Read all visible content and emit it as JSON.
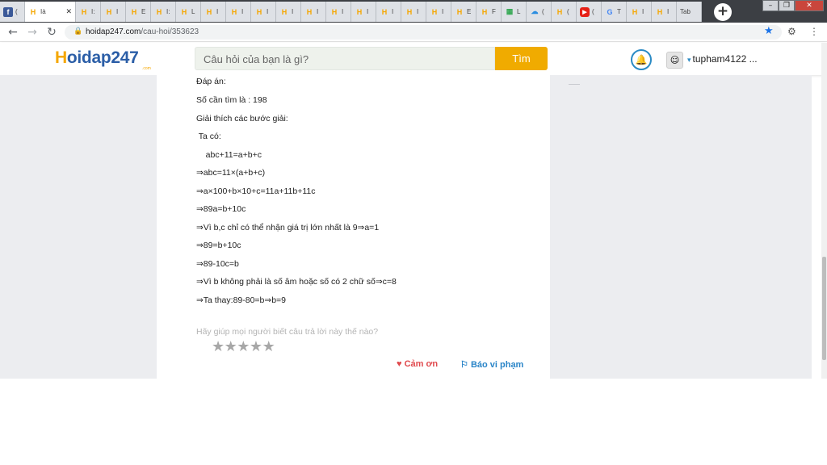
{
  "browser": {
    "tabs": [
      {
        "icon": "facebook-icon",
        "label": "("
      },
      {
        "icon": "hoidap-icon",
        "label": "Ià",
        "active": true
      },
      {
        "icon": "hoidap-icon",
        "label": "I:"
      },
      {
        "icon": "hoidap-icon",
        "label": "I"
      },
      {
        "icon": "hoidap-icon",
        "label": "E"
      },
      {
        "icon": "hoidap-icon",
        "label": "I:"
      },
      {
        "icon": "hoidap-icon",
        "label": "L"
      },
      {
        "icon": "hoidap-icon",
        "label": "I"
      },
      {
        "icon": "hoidap-icon",
        "label": "I"
      },
      {
        "icon": "hoidap-icon",
        "label": "I"
      },
      {
        "icon": "hoidap-icon",
        "label": "I"
      },
      {
        "icon": "hoidap-icon",
        "label": "I"
      },
      {
        "icon": "hoidap-icon",
        "label": "I"
      },
      {
        "icon": "hoidap-icon",
        "label": "I"
      },
      {
        "icon": "hoidap-icon",
        "label": "I"
      },
      {
        "icon": "hoidap-icon",
        "label": "I"
      },
      {
        "icon": "hoidap-icon",
        "label": "I"
      },
      {
        "icon": "hoidap-icon",
        "label": "E"
      },
      {
        "icon": "hoidap-icon",
        "label": "F"
      },
      {
        "icon": "sheets-icon",
        "label": "L"
      },
      {
        "icon": "cloud-icon",
        "label": "("
      },
      {
        "icon": "hoidap-icon",
        "label": "("
      },
      {
        "icon": "youtube-icon",
        "label": "("
      },
      {
        "icon": "google-icon",
        "label": "T"
      },
      {
        "icon": "hoidap-icon",
        "label": "I"
      },
      {
        "icon": "hoidap-icon",
        "label": "I"
      },
      {
        "icon": "none",
        "label": "Tab"
      }
    ],
    "url_domain": "hoidap247.com",
    "url_path": "/cau-hoi/353623"
  },
  "header": {
    "logo_h": "H",
    "logo_rest": "oidap247",
    "logo_sub": ".com",
    "search_placeholder": "Câu hỏi của bạn là gì?",
    "search_button": "Tìm",
    "username": "tupham4122 ..."
  },
  "answer": {
    "lines": [
      "Đáp án:",
      "Số cần tìm là : 198",
      "Giải thích các bước giải:",
      " Ta có:",
      "    abc+11=a+b+c",
      "⇒abc=11×(a+b+c)",
      "⇒a×100+b×10+c=11a+11b+11c",
      "⇒89a=b+10c",
      "⇒Vì b,c chỉ có thể nhận giá trị lớn nhất là 9⇒a=1",
      "⇒89=b+10c",
      "⇒89-10c=b",
      "⇒Vì b không phải là số âm hoặc số có 2 chữ số⇒c=8",
      "⇒Ta thay:89-80=b⇒b=9"
    ],
    "rating_question": "Hãy giúp mọi người biết câu trả lời này thế nào?",
    "rating_value": 0,
    "rating_max": 5,
    "thanks_label": "Cảm ơn",
    "report_label": "Báo vi phạm"
  }
}
